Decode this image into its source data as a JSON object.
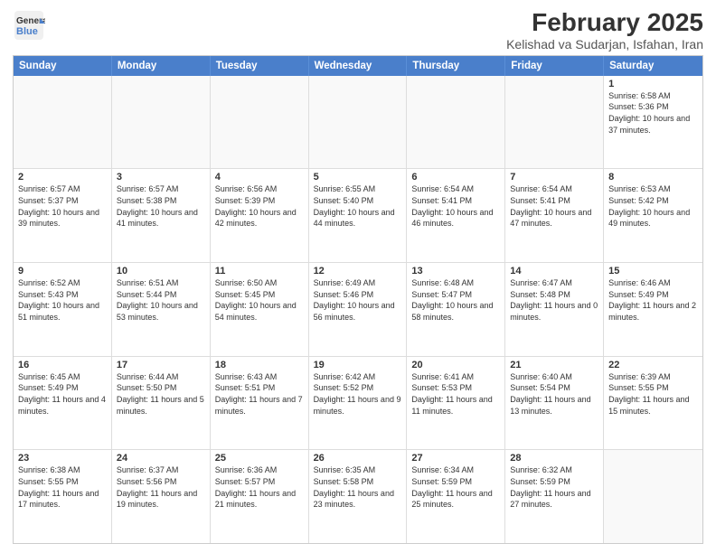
{
  "header": {
    "logo_line1": "General",
    "logo_line2": "Blue",
    "title": "February 2025",
    "subtitle": "Kelishad va Sudarjan, Isfahan, Iran"
  },
  "days_of_week": [
    "Sunday",
    "Monday",
    "Tuesday",
    "Wednesday",
    "Thursday",
    "Friday",
    "Saturday"
  ],
  "weeks": [
    [
      {
        "day": "",
        "info": ""
      },
      {
        "day": "",
        "info": ""
      },
      {
        "day": "",
        "info": ""
      },
      {
        "day": "",
        "info": ""
      },
      {
        "day": "",
        "info": ""
      },
      {
        "day": "",
        "info": ""
      },
      {
        "day": "1",
        "info": "Sunrise: 6:58 AM\nSunset: 5:36 PM\nDaylight: 10 hours and 37 minutes."
      }
    ],
    [
      {
        "day": "2",
        "info": "Sunrise: 6:57 AM\nSunset: 5:37 PM\nDaylight: 10 hours and 39 minutes."
      },
      {
        "day": "3",
        "info": "Sunrise: 6:57 AM\nSunset: 5:38 PM\nDaylight: 10 hours and 41 minutes."
      },
      {
        "day": "4",
        "info": "Sunrise: 6:56 AM\nSunset: 5:39 PM\nDaylight: 10 hours and 42 minutes."
      },
      {
        "day": "5",
        "info": "Sunrise: 6:55 AM\nSunset: 5:40 PM\nDaylight: 10 hours and 44 minutes."
      },
      {
        "day": "6",
        "info": "Sunrise: 6:54 AM\nSunset: 5:41 PM\nDaylight: 10 hours and 46 minutes."
      },
      {
        "day": "7",
        "info": "Sunrise: 6:54 AM\nSunset: 5:41 PM\nDaylight: 10 hours and 47 minutes."
      },
      {
        "day": "8",
        "info": "Sunrise: 6:53 AM\nSunset: 5:42 PM\nDaylight: 10 hours and 49 minutes."
      }
    ],
    [
      {
        "day": "9",
        "info": "Sunrise: 6:52 AM\nSunset: 5:43 PM\nDaylight: 10 hours and 51 minutes."
      },
      {
        "day": "10",
        "info": "Sunrise: 6:51 AM\nSunset: 5:44 PM\nDaylight: 10 hours and 53 minutes."
      },
      {
        "day": "11",
        "info": "Sunrise: 6:50 AM\nSunset: 5:45 PM\nDaylight: 10 hours and 54 minutes."
      },
      {
        "day": "12",
        "info": "Sunrise: 6:49 AM\nSunset: 5:46 PM\nDaylight: 10 hours and 56 minutes."
      },
      {
        "day": "13",
        "info": "Sunrise: 6:48 AM\nSunset: 5:47 PM\nDaylight: 10 hours and 58 minutes."
      },
      {
        "day": "14",
        "info": "Sunrise: 6:47 AM\nSunset: 5:48 PM\nDaylight: 11 hours and 0 minutes."
      },
      {
        "day": "15",
        "info": "Sunrise: 6:46 AM\nSunset: 5:49 PM\nDaylight: 11 hours and 2 minutes."
      }
    ],
    [
      {
        "day": "16",
        "info": "Sunrise: 6:45 AM\nSunset: 5:49 PM\nDaylight: 11 hours and 4 minutes."
      },
      {
        "day": "17",
        "info": "Sunrise: 6:44 AM\nSunset: 5:50 PM\nDaylight: 11 hours and 5 minutes."
      },
      {
        "day": "18",
        "info": "Sunrise: 6:43 AM\nSunset: 5:51 PM\nDaylight: 11 hours and 7 minutes."
      },
      {
        "day": "19",
        "info": "Sunrise: 6:42 AM\nSunset: 5:52 PM\nDaylight: 11 hours and 9 minutes."
      },
      {
        "day": "20",
        "info": "Sunrise: 6:41 AM\nSunset: 5:53 PM\nDaylight: 11 hours and 11 minutes."
      },
      {
        "day": "21",
        "info": "Sunrise: 6:40 AM\nSunset: 5:54 PM\nDaylight: 11 hours and 13 minutes."
      },
      {
        "day": "22",
        "info": "Sunrise: 6:39 AM\nSunset: 5:55 PM\nDaylight: 11 hours and 15 minutes."
      }
    ],
    [
      {
        "day": "23",
        "info": "Sunrise: 6:38 AM\nSunset: 5:55 PM\nDaylight: 11 hours and 17 minutes."
      },
      {
        "day": "24",
        "info": "Sunrise: 6:37 AM\nSunset: 5:56 PM\nDaylight: 11 hours and 19 minutes."
      },
      {
        "day": "25",
        "info": "Sunrise: 6:36 AM\nSunset: 5:57 PM\nDaylight: 11 hours and 21 minutes."
      },
      {
        "day": "26",
        "info": "Sunrise: 6:35 AM\nSunset: 5:58 PM\nDaylight: 11 hours and 23 minutes."
      },
      {
        "day": "27",
        "info": "Sunrise: 6:34 AM\nSunset: 5:59 PM\nDaylight: 11 hours and 25 minutes."
      },
      {
        "day": "28",
        "info": "Sunrise: 6:32 AM\nSunset: 5:59 PM\nDaylight: 11 hours and 27 minutes."
      },
      {
        "day": "",
        "info": ""
      }
    ]
  ]
}
